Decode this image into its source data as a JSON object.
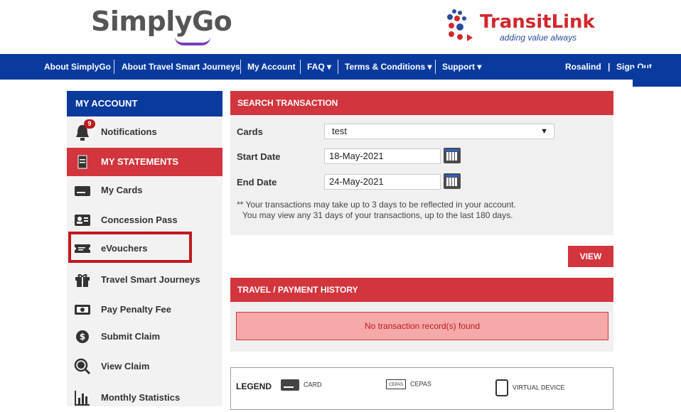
{
  "header": {
    "simplygo_logo": "SimplyGo",
    "transitlink_logo": "TransitLink",
    "transitlink_tagline": "adding value always"
  },
  "nav": {
    "items": [
      "About SimplyGo",
      "About Travel Smart Journeys",
      "My Account",
      "FAQ ▾",
      "Terms & Conditions ▾",
      "Support ▾"
    ],
    "user": "Rosalind",
    "signout": "Sign Out"
  },
  "sidebar": {
    "title": "MY ACCOUNT",
    "notification_count": "9",
    "items": [
      {
        "label": "Notifications",
        "icon": "bell-icon"
      },
      {
        "label": "MY STATEMENTS",
        "icon": "statement-icon"
      },
      {
        "label": "My Cards",
        "icon": "card-icon"
      },
      {
        "label": "Concession Pass",
        "icon": "id-card-icon"
      },
      {
        "label": "eVouchers",
        "icon": "voucher-icon"
      },
      {
        "label": "Travel Smart Journeys",
        "icon": "gift-icon"
      },
      {
        "label": "Pay Penalty Fee",
        "icon": "banknote-icon"
      },
      {
        "label": "Submit Claim",
        "icon": "dollar-coin-icon"
      },
      {
        "label": "View Claim",
        "icon": "search-dollar-icon"
      },
      {
        "label": "Monthly Statistics",
        "icon": "bar-chart-icon"
      }
    ]
  },
  "search": {
    "title": "SEARCH TRANSACTION",
    "cards_label": "Cards",
    "cards_value": "test",
    "start_label": "Start Date",
    "start_value": "18-May-2021",
    "end_label": "End Date",
    "end_value": "24-May-2021",
    "note1": "** Your transactions may take up to 3 days to be reflected in your account.",
    "note2": "You may view any 31 days of your transactions, up to the last 180 days.",
    "view_button": "VIEW"
  },
  "history": {
    "title": "TRAVEL / PAYMENT HISTORY",
    "empty_message": "No transaction record(s) found"
  },
  "legend": {
    "title": "LEGEND",
    "items": [
      "CARD",
      "CEPAS",
      "VIRTUAL DEVICE"
    ],
    "cepas_icon_text": "CEPAS"
  },
  "colors": {
    "nav_blue": "#0a3a9e",
    "accent_red": "#d2353d"
  }
}
